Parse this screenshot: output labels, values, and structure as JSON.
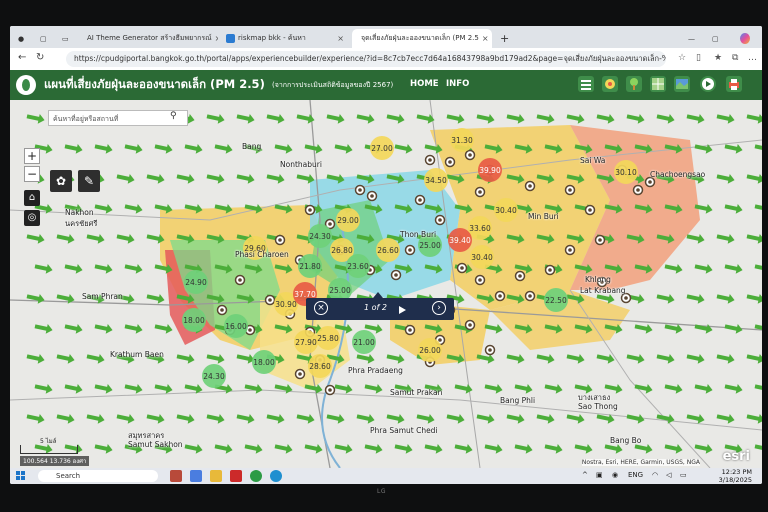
{
  "browser": {
    "tabs": [
      {
        "label": "AI Theme Generator สร้างธีมพยากรณ์"
      },
      {
        "label": "riskmap bkk - ค้นหา"
      },
      {
        "label": "จุดเสี่ยงภัยฝุ่นละอองขนาดเล็ก (PM 2.5"
      }
    ],
    "url": "https://cpudgiportal.bangkok.go.th/portal/apps/experiencebuilder/experience/?id=8c7cb7ecc7d64a16843798a9bd179ad2&page=จุดเสี่ยงภัยฝุ่นละอองขนาดเล็ก-%28"
  },
  "app": {
    "title": "แผนที่เสี่ยงภัยฝุ่นละอองขนาดเล็ก (PM 2.5)",
    "subtitle": "(จากการประเมินสถิติข้อมูลของปี 2567)",
    "nav_home": "HOME",
    "nav_info": "INFO"
  },
  "map": {
    "search_placeholder": "ค้นหาที่อยู่หรือสถานที่",
    "popup_label": "1 of 2",
    "scale_label": "5 ไมล์",
    "coords": "100.564 13.736 องศา",
    "attribution": "Nostra, Esri, HERE, Garmin, USGS, NGA",
    "esri_logo": "esri",
    "places": [
      {
        "name": "Bang",
        "id": "p1"
      },
      {
        "name": "Nonthaburi",
        "id": "p2"
      },
      {
        "name": "Sai Wa",
        "id": "p3"
      },
      {
        "name": "Nakhon",
        "id": "p4"
      },
      {
        "name": "นครชัยศรี",
        "id": "p5"
      },
      {
        "name": "Min Buri",
        "id": "p6"
      },
      {
        "name": "Sam Phran",
        "id": "p7"
      },
      {
        "name": "Khlong",
        "id": "p8"
      },
      {
        "name": "Phra Pradaeng",
        "id": "p9"
      },
      {
        "name": "Samut Prakan",
        "id": "p10"
      },
      {
        "name": "Bang Phli",
        "id": "p11"
      },
      {
        "name": "บางเสาธง",
        "id": "p12"
      },
      {
        "name": "Sao Thong",
        "id": "p13"
      },
      {
        "name": "Phra Samut Chedi",
        "id": "p14"
      },
      {
        "name": "Bang Bo",
        "id": "p15"
      },
      {
        "name": "สมุทรสาคร",
        "id": "p16"
      },
      {
        "name": "Samut Sakhon",
        "id": "p17"
      },
      {
        "name": "Krathum Baen",
        "id": "p18"
      },
      {
        "name": "Chachoengsao",
        "id": "p19"
      },
      {
        "name": "Lat Krabang",
        "id": "p20"
      },
      {
        "name": "Thon Buri",
        "id": "p21"
      },
      {
        "name": "Phasi Charoen",
        "id": "p22"
      }
    ],
    "pm_values": [
      {
        "value": "27.00",
        "level": "yellow"
      },
      {
        "value": "31.30",
        "level": "yellow"
      },
      {
        "value": "39.90",
        "level": "red"
      },
      {
        "value": "34.50",
        "level": "yellow"
      },
      {
        "value": "30.10",
        "level": "yellow"
      },
      {
        "value": "29.00",
        "level": "yellow"
      },
      {
        "value": "29.60",
        "level": "yellow"
      },
      {
        "value": "24.30",
        "level": "green"
      },
      {
        "value": "26.80",
        "level": "yellow"
      },
      {
        "value": "23.60",
        "level": "green"
      },
      {
        "value": "21.80",
        "level": "green"
      },
      {
        "value": "26.60",
        "level": "yellow"
      },
      {
        "value": "25.00",
        "level": "green"
      },
      {
        "value": "33.60",
        "level": "yellow"
      },
      {
        "value": "39.40",
        "level": "red"
      },
      {
        "value": "30.40",
        "level": "yellow"
      },
      {
        "value": "30.40",
        "level": "yellow"
      },
      {
        "value": "24.90",
        "level": "green"
      },
      {
        "value": "30.90",
        "level": "yellow"
      },
      {
        "value": "37.70",
        "level": "red"
      },
      {
        "value": "25.00",
        "level": "green"
      },
      {
        "value": "18.00",
        "level": "green"
      },
      {
        "value": "16.00",
        "level": "green"
      },
      {
        "value": "22.50",
        "level": "green"
      },
      {
        "value": "27.90",
        "level": "yellow"
      },
      {
        "value": "25.80",
        "level": "yellow"
      },
      {
        "value": "21.00",
        "level": "green"
      },
      {
        "value": "18.00",
        "level": "green"
      },
      {
        "value": "28.60",
        "level": "yellow"
      },
      {
        "value": "26.00",
        "level": "yellow"
      },
      {
        "value": "24.30",
        "level": "green"
      }
    ],
    "level_colors": {
      "green": "#6fd07a",
      "yellow": "#f3d75a",
      "red": "#e85b45"
    }
  },
  "taskbar": {
    "search_label": "Search",
    "lang": "ENG",
    "time": "12:23 PM",
    "date": "3/18/2025"
  },
  "monitor_brand": "LG"
}
